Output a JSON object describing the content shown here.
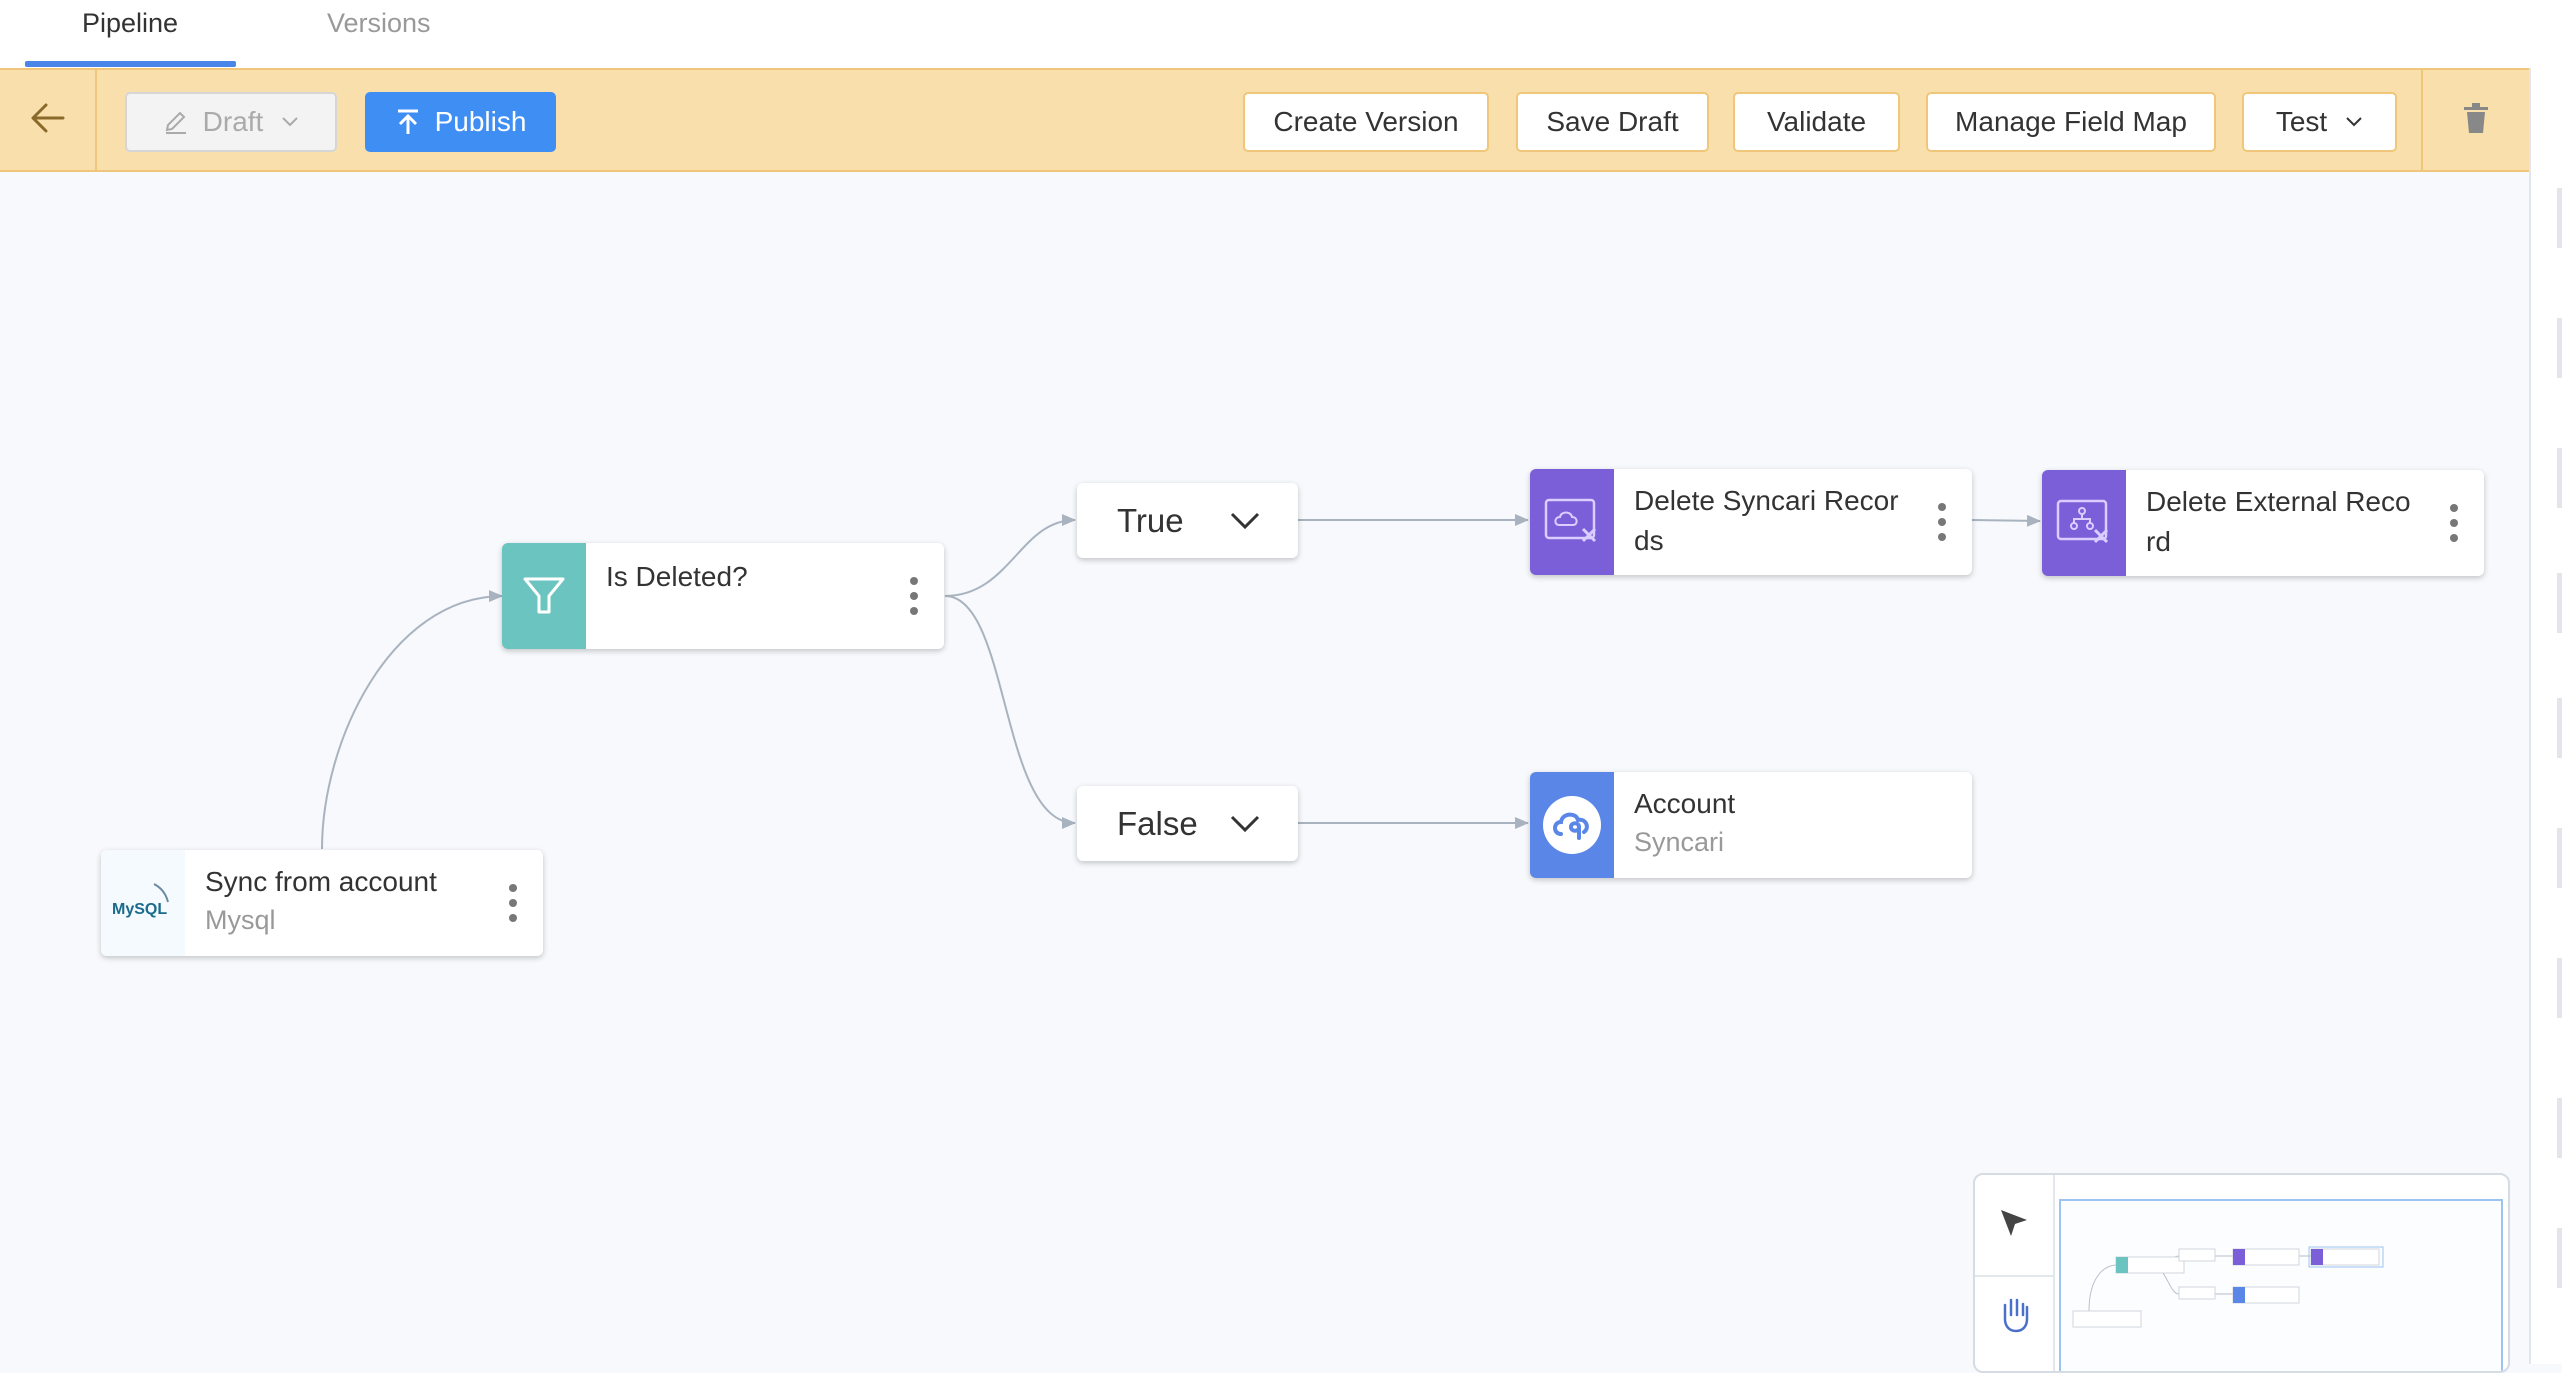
{
  "tabs": [
    {
      "label": "Pipeline",
      "active": true
    },
    {
      "label": "Versions",
      "active": false
    }
  ],
  "toolbar": {
    "back_icon": "arrow-left-icon",
    "draft_label": "Draft",
    "publish_label": "Publish",
    "create_version_label": "Create Version",
    "save_draft_label": "Save Draft",
    "validate_label": "Validate",
    "manage_field_map_label": "Manage Field Map",
    "test_label": "Test",
    "trash_icon": "trash-icon"
  },
  "nodes": {
    "source": {
      "title": "Sync from  account",
      "subtitle": "Mysql",
      "icon": "mysql-logo",
      "logo_text": "MySQL"
    },
    "filter": {
      "title": "Is Deleted?",
      "icon": "filter-funnel-icon",
      "color": "#6cc4c0"
    },
    "branch_true": {
      "label": "True"
    },
    "branch_false": {
      "label": "False"
    },
    "delete_syncari": {
      "title": "Delete Syncari Records",
      "icon": "delete-record-icon",
      "color": "#7b5fd8"
    },
    "delete_external": {
      "title": "Delete External Record",
      "icon": "delete-external-icon",
      "color": "#7b5fd8"
    },
    "account": {
      "title": "Account",
      "subtitle": "Syncari",
      "icon": "syncari-cloud-icon",
      "color": "#5a86e8"
    }
  },
  "colors": {
    "toolbar_bg": "#f9dfab",
    "toolbar_border": "#f0c77a",
    "publish": "#3f8ef4",
    "tab_underline": "#4a86e8",
    "edge": "#a9b3bf"
  },
  "minimap": {
    "tools": [
      "pointer-icon",
      "hand-icon"
    ]
  }
}
